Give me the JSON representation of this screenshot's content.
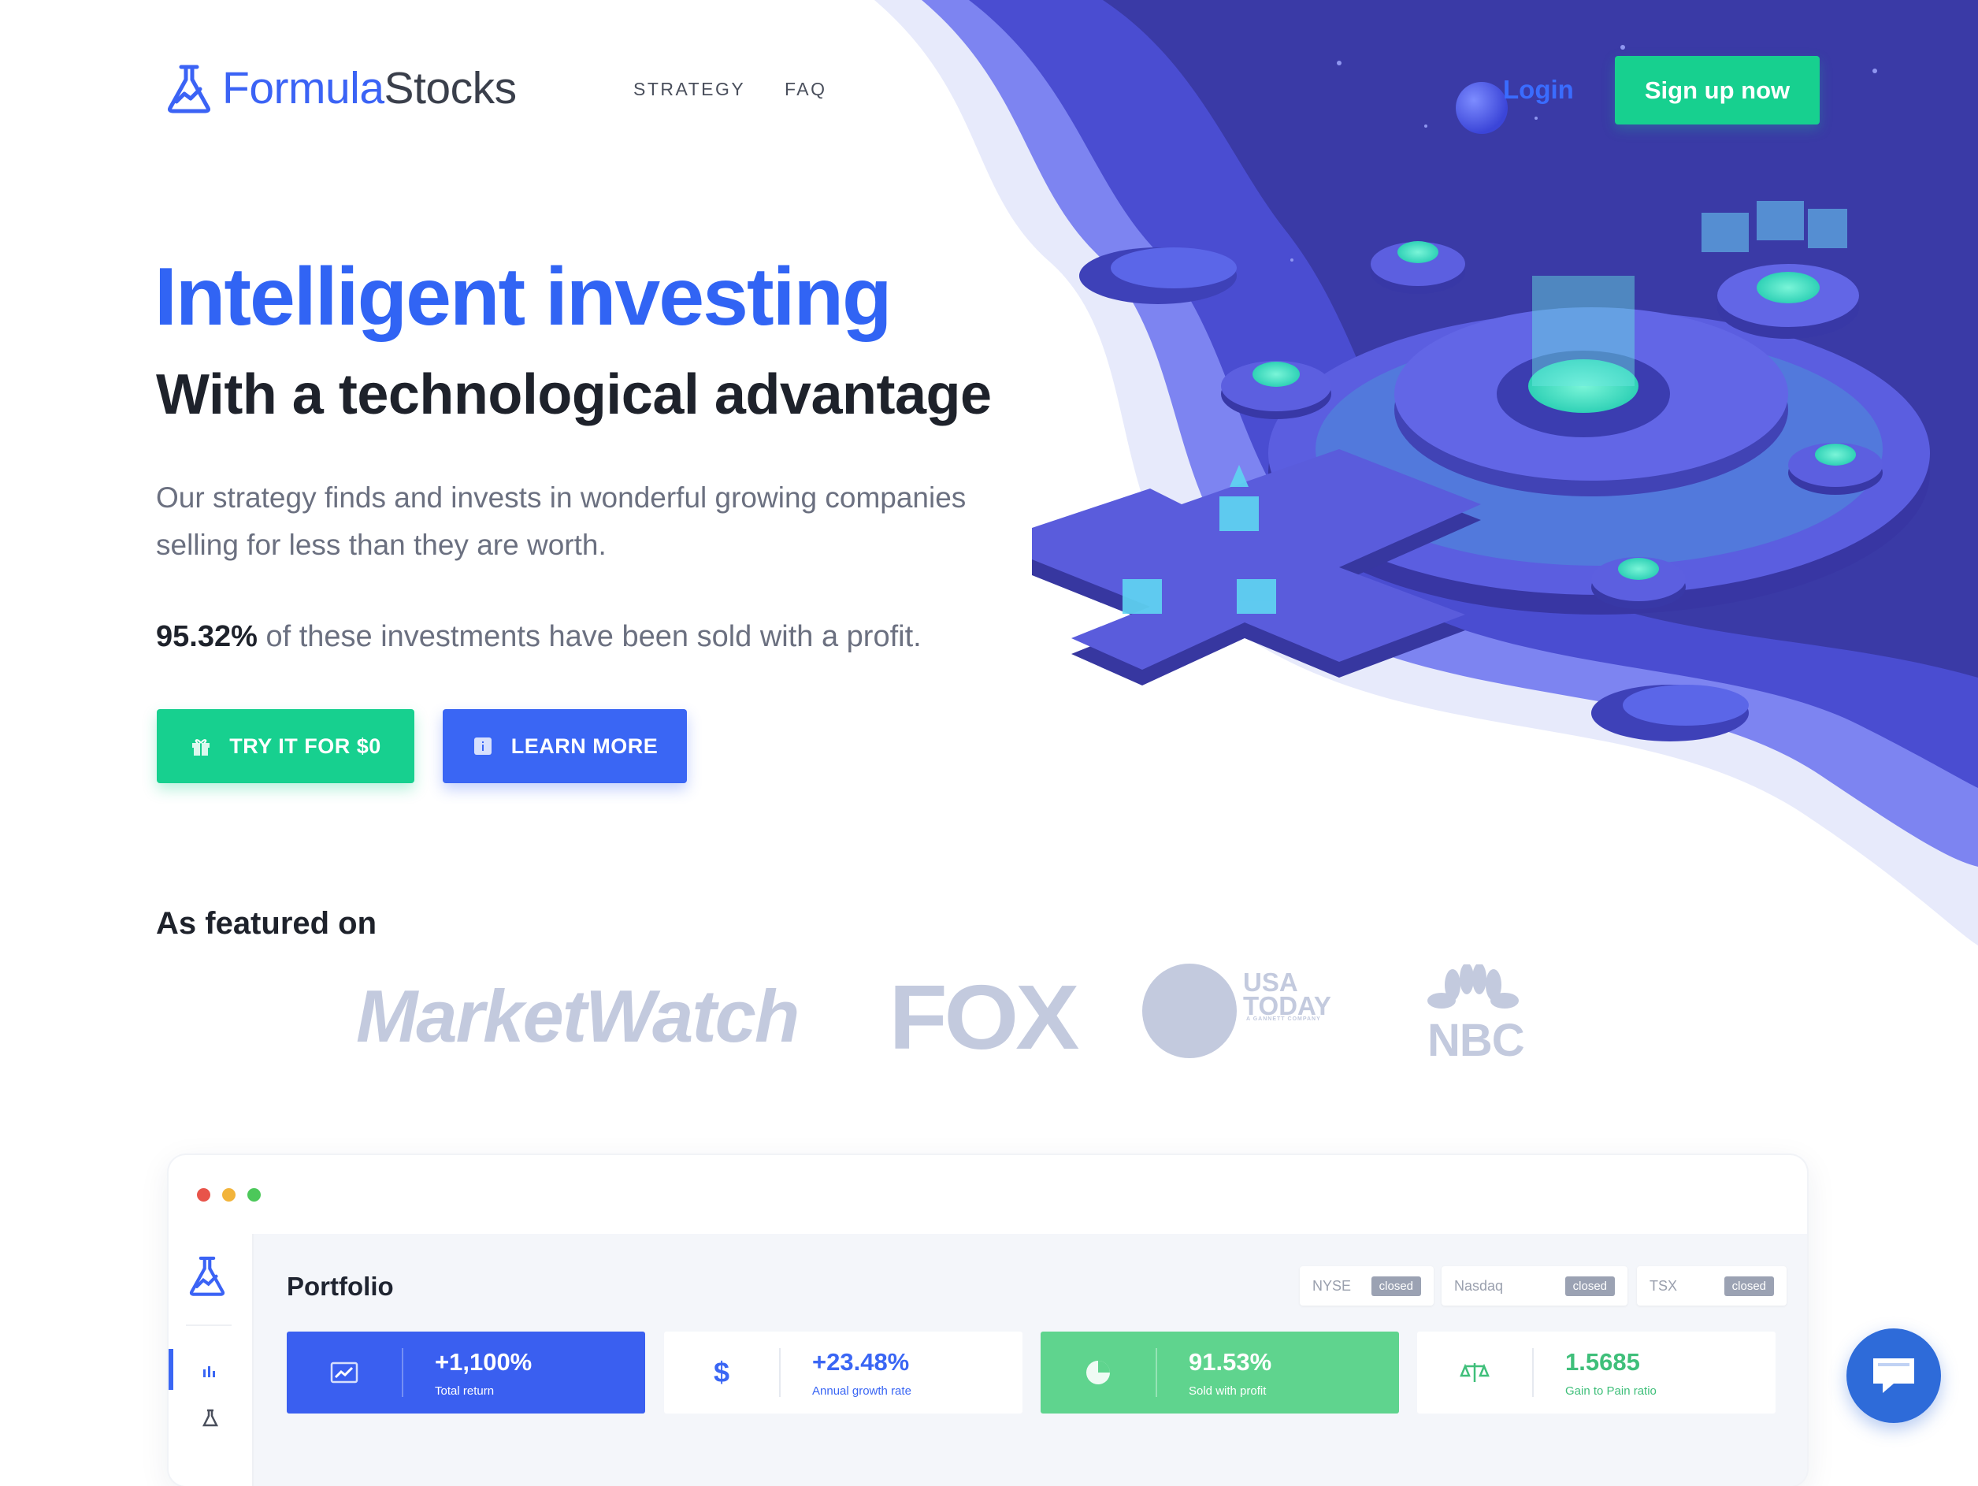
{
  "brand": {
    "part1": "Formula",
    "part2": "Stocks"
  },
  "nav": {
    "strategy": "STRATEGY",
    "faq": "FAQ",
    "login": "Login",
    "signup": "Sign up now"
  },
  "hero": {
    "title": "Intelligent investing",
    "subtitle": "With a technological advantage",
    "lead": "Our strategy finds and invests in wonderful growing companies selling for less than they are worth.",
    "stat_value": "95.32%",
    "stat_text": " of these investments have been sold with a profit.",
    "cta_try": "TRY IT FOR $0",
    "cta_learn": "LEARN MORE"
  },
  "featured": {
    "title": "As featured on",
    "logos": {
      "marketwatch": "MarketWatch",
      "fox": "FOX",
      "usa_line1": "USA",
      "usa_line2": "TODAY",
      "usa_sub": "A GANNETT COMPANY",
      "nbc": "NBC"
    }
  },
  "dashboard": {
    "title": "Portfolio",
    "exchanges": [
      {
        "name": "NYSE",
        "status": "closed"
      },
      {
        "name": "Nasdaq",
        "status": "closed"
      },
      {
        "name": "TSX",
        "status": "closed"
      }
    ],
    "kpis": [
      {
        "value": "+1,100%",
        "label": "Total return",
        "icon": "chart-up-icon"
      },
      {
        "value": "+23.48%",
        "label": "Annual growth rate",
        "icon": "dollar-icon"
      },
      {
        "value": "91.53%",
        "label": "Sold with profit",
        "icon": "pie-icon"
      },
      {
        "value": "1.5685",
        "label": "Gain to Pain ratio",
        "icon": "scale-icon"
      }
    ]
  },
  "colors": {
    "primary": "#3164f4",
    "green": "#17d08f",
    "dark": "#1e222b",
    "purple": "#3d3aa8"
  }
}
